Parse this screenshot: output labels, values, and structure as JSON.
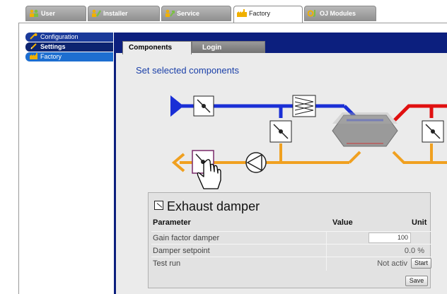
{
  "top_tabs": [
    {
      "label": "User",
      "icon": "user-icon",
      "active": false
    },
    {
      "label": "Installer",
      "icon": "installer-icon",
      "active": false
    },
    {
      "label": "Service",
      "icon": "service-icon",
      "active": false
    },
    {
      "label": "Factory",
      "icon": "factory-icon",
      "active": true
    },
    {
      "label": "OJ Modules",
      "icon": "oj-modules-icon",
      "active": false
    }
  ],
  "side_menu": [
    {
      "label": "Configuration",
      "icon": "wrench-icon"
    },
    {
      "label": "Settings",
      "icon": "pencil-icon"
    },
    {
      "label": "Factory",
      "icon": "factory-icon"
    }
  ],
  "sub_tabs": {
    "components": "Components",
    "login": "Login"
  },
  "page_title": "Set selected components",
  "component": {
    "title": "Exhaust damper",
    "headers": {
      "parameter": "Parameter",
      "value": "Value",
      "unit": "Unit"
    },
    "rows": [
      {
        "name": "Gain factor damper",
        "value": "100",
        "unit": ""
      },
      {
        "name": "Damper setpoint",
        "value": "0.0",
        "unit": "%"
      },
      {
        "name": "Test run",
        "value": "Not activ",
        "unit": ""
      }
    ],
    "start_label": "Start",
    "save_label": "Save"
  },
  "colors": {
    "navy": "#0c1f7e",
    "supply_air": "#1a2fd6",
    "exhaust_air": "#f0a020",
    "warm_air": "#e01010",
    "heat_exchanger": "#9a9a9a"
  }
}
